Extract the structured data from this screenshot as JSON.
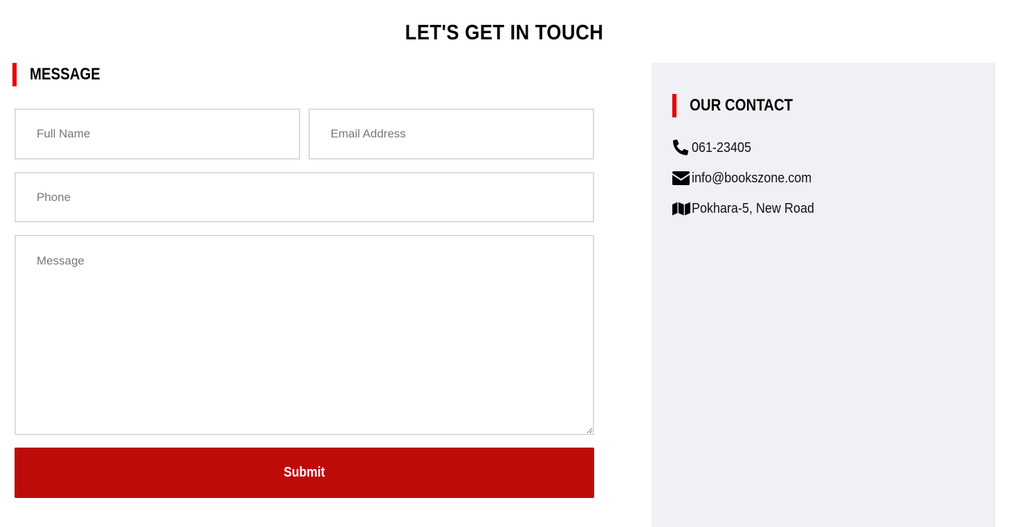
{
  "page": {
    "title": "LET'S GET IN TOUCH"
  },
  "message_section": {
    "heading": "MESSAGE",
    "fields": {
      "full_name": {
        "placeholder": "Full Name",
        "value": ""
      },
      "email": {
        "placeholder": "Email Address",
        "value": ""
      },
      "phone": {
        "placeholder": "Phone",
        "value": ""
      },
      "message": {
        "placeholder": "Message",
        "value": ""
      }
    },
    "submit_label": "Submit"
  },
  "contact_section": {
    "heading": "OUR CONTACT",
    "phone": "061-23405",
    "email": "info@bookszone.com",
    "address": "Pokhara-5, New Road",
    "icons": [
      "phone-icon",
      "envelope-icon",
      "map-icon"
    ]
  },
  "colors": {
    "accent_bar": "#e60000",
    "submit_bg": "#bf0a0a",
    "panel_bg": "#f0f1f5",
    "field_border": "#dcdcdc"
  }
}
